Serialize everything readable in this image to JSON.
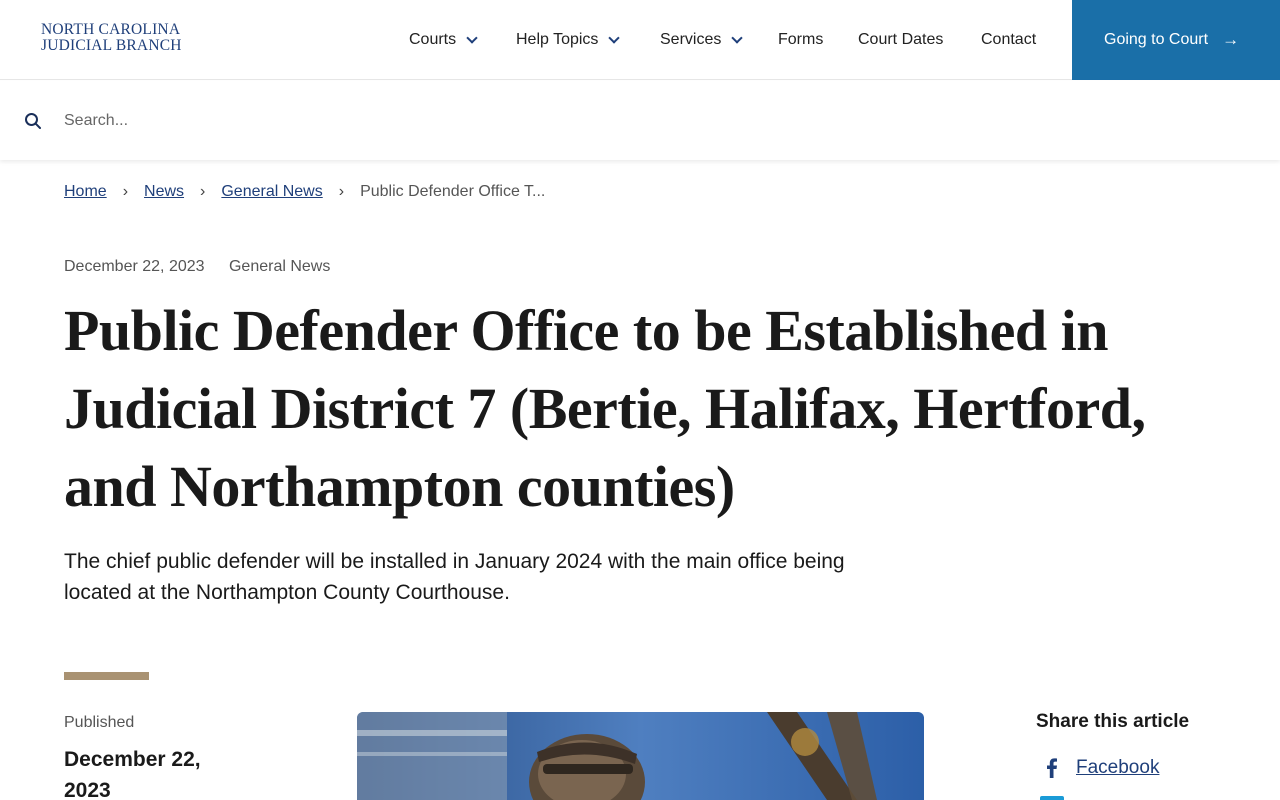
{
  "header": {
    "logo_line1": "NORTH CAROLINA",
    "logo_line2": "JUDICIAL BRANCH",
    "nav": [
      {
        "label": "Courts",
        "dropdown": true
      },
      {
        "label": "Help Topics",
        "dropdown": true
      },
      {
        "label": "Services",
        "dropdown": true
      },
      {
        "label": "Forms",
        "dropdown": false
      },
      {
        "label": "Court Dates",
        "dropdown": false
      },
      {
        "label": "Contact",
        "dropdown": false
      }
    ],
    "cta_label": "Going to Court",
    "cta_color": "#1a6fa8"
  },
  "search": {
    "placeholder": "Search...",
    "value": ""
  },
  "breadcrumb": {
    "items": [
      "Home",
      "News",
      "General News"
    ],
    "current": "Public Defender Office T..."
  },
  "article": {
    "date": "December 22, 2023",
    "category": "General News",
    "title": "Public Defender Office to be Established in Judicial District 7 (Bertie, Halifax, Hertford, and Northampton counties)",
    "lede": "The chief public defender will be installed in January 2024 with the main office being located at the Northampton County Courthouse.",
    "published_label": "Published",
    "published_date": "December 22, 2023",
    "accent_color": "#a99272"
  },
  "share": {
    "title": "Share this article",
    "facebook_label": "Facebook"
  },
  "colors": {
    "brand_blue": "#1f3f7a",
    "link_blue": "#1f3f7a"
  }
}
